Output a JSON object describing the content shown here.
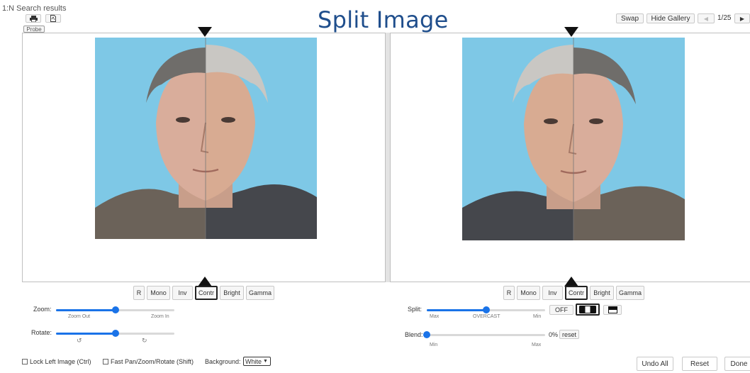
{
  "header": {
    "search_results_label": "1:N Search results",
    "print_icon": "printer-icon",
    "pdf_icon": "pdf-icon",
    "probe_tag": "Probe",
    "title": "Split Image",
    "swap_label": "Swap",
    "hide_gallery_label": "Hide Gallery",
    "page_indicator": "1/25"
  },
  "left_panel": {
    "tools": [
      "R",
      "Mono",
      "Inv",
      "Contr",
      "Bright",
      "Gamma"
    ],
    "active_tool": "Contr",
    "zoom": {
      "label": "Zoom:",
      "min_label": "Zoom Out",
      "max_label": "Zoom In",
      "value": 0.5
    },
    "rotate": {
      "label": "Rotate:",
      "value": 0.5
    }
  },
  "right_panel": {
    "tools": [
      "R",
      "Mono",
      "Inv",
      "Contr",
      "Bright",
      "Gamma"
    ],
    "active_tool": "Contr",
    "split": {
      "label": "Split:",
      "min_label": "Max",
      "mid_label": "OVERCAST",
      "max_label": "Min",
      "value": 0.5
    },
    "split_modes": {
      "off_label": "OFF",
      "vertical_icon": "split-vertical-icon",
      "horizontal_icon": "split-horizontal-icon"
    },
    "blend": {
      "label": "Blend:",
      "min_label": "Min",
      "max_label": "Max",
      "percent": "0%",
      "reset_label": "reset",
      "value": 0
    }
  },
  "footer": {
    "lock_left_label": "Lock Left Image (Ctrl)",
    "fast_pan_label": "Fast Pan/Zoom/Rotate (Shift)",
    "background_label": "Background:",
    "background_value": "White",
    "undo_all_label": "Undo All",
    "reset_label": "Reset",
    "done_label": "Done"
  },
  "colors": {
    "accent": "#1a73e8",
    "title": "#1f4e8c",
    "photo_bg": "#7ec8e6"
  }
}
